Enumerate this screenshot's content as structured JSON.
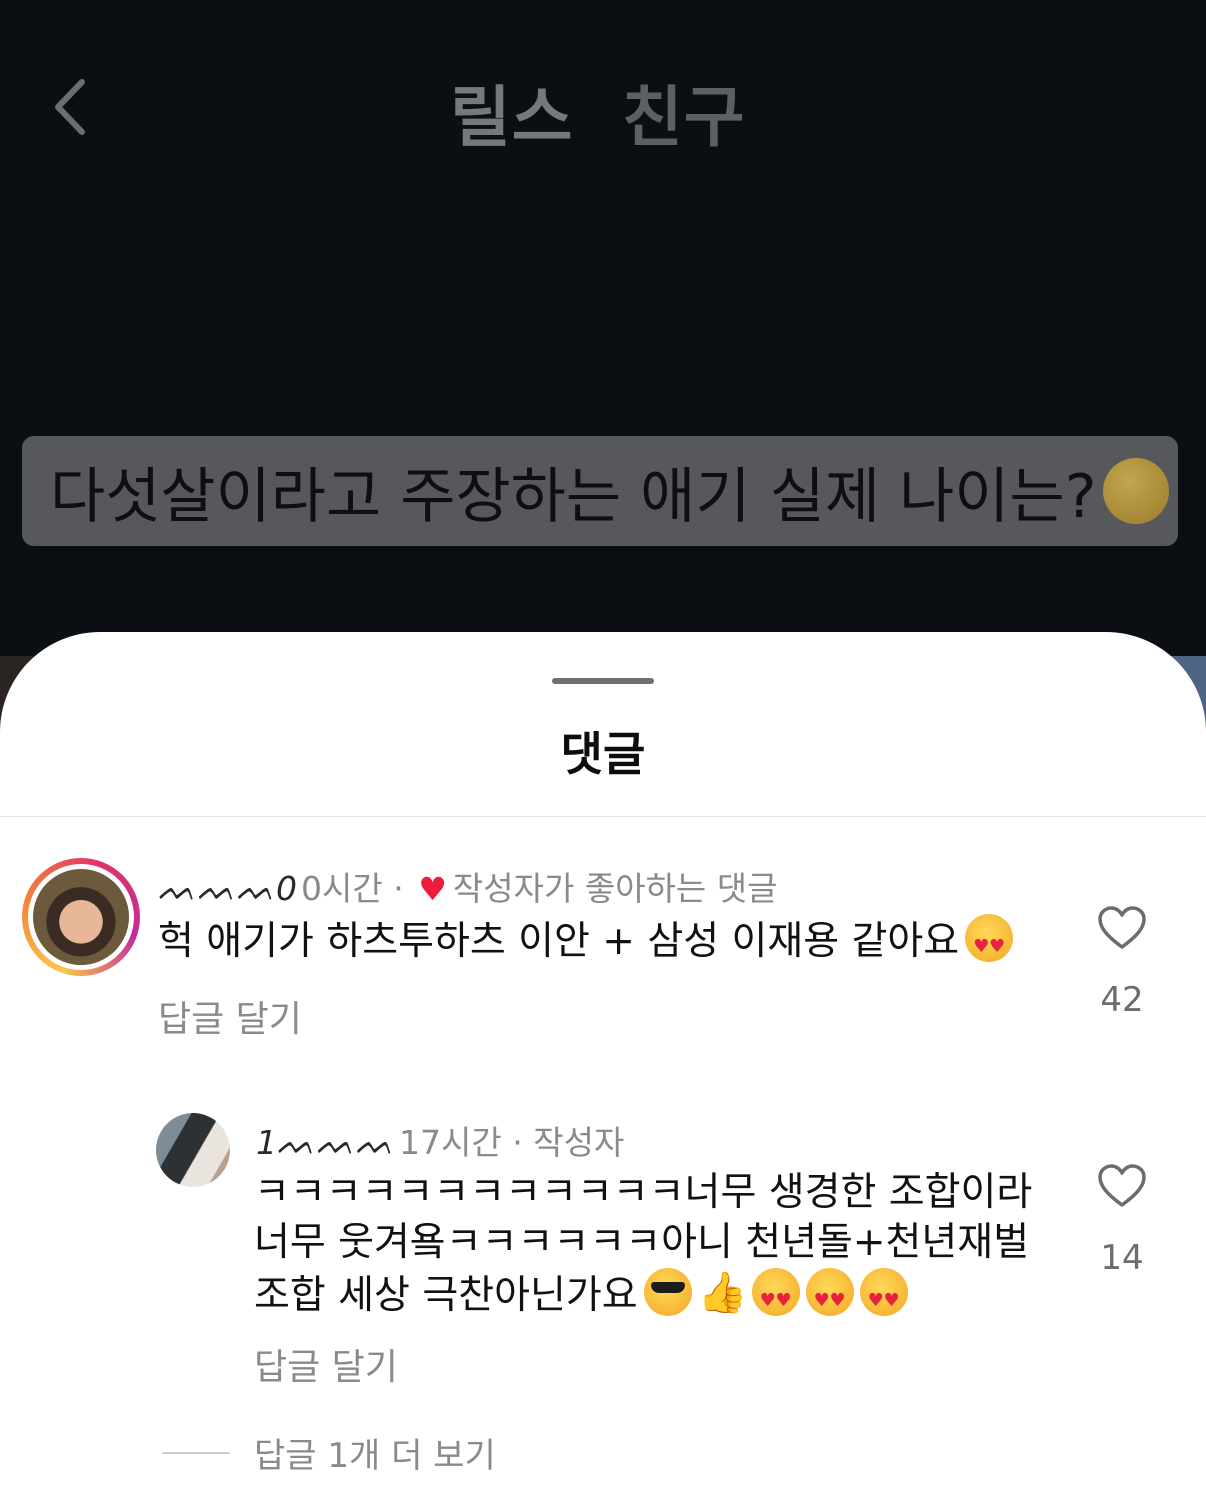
{
  "header": {
    "tabs": [
      {
        "label": "릴스"
      },
      {
        "label": "친구"
      }
    ]
  },
  "video": {
    "caption": "다섯살이라고 주장하는 애기 실제 나이는?"
  },
  "sheet": {
    "title": "댓글"
  },
  "comments": [
    {
      "username": "ᨓᨓᨓ0",
      "time": "0시간",
      "separator": "·",
      "liked_by_author_label": "작성자가 좋아하는 댓글",
      "text": "헉 애기가 하츠투하츠 이안 + 삼성 이재용 같아요",
      "emojis": [
        "heart-eyes"
      ],
      "reply_label": "답글 달기",
      "like_count": "42"
    },
    {
      "username": "1ᨓᨓᨓ",
      "time": "17시간",
      "separator": "·",
      "author_label": "작성자",
      "text_lines": [
        "ㅋㅋㅋㅋㅋㅋㅋㅋㅋㅋㅋㅋ너무 생경한 조합이라",
        "너무 웃겨욬ㅋㅋㅋㅋㅋㅋ아니 천년돌+천년재벌",
        "조합 세상 극찬아닌가요"
      ],
      "emojis": [
        "sunglasses",
        "thumbsup",
        "heart-eyes",
        "heart-eyes",
        "heart-eyes"
      ],
      "reply_label": "답글 달기",
      "like_count": "14"
    }
  ],
  "more_replies_label": "답글 1개 더 보기",
  "colors": {
    "background": "#0b0e12",
    "sheet": "#ffffff",
    "like_heart": "#ed1c3a",
    "secondary_text": "#8a8a8e"
  }
}
